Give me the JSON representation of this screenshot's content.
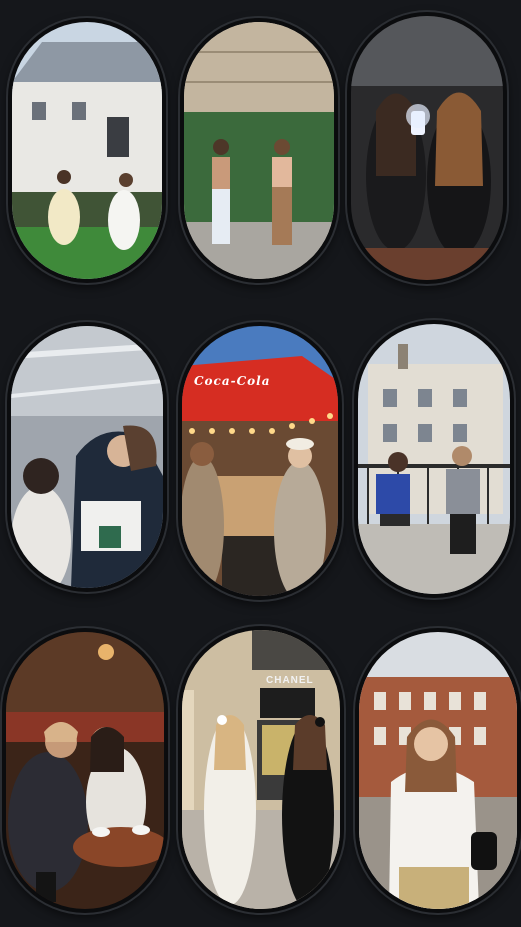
{
  "gallery": {
    "photos": [
      {
        "id": "p1",
        "depicts": "two-friends-dancing-lawn"
      },
      {
        "id": "p2",
        "depicts": "two-friends-dancing-street"
      },
      {
        "id": "p3",
        "depicts": "mirror-selfie-pair"
      },
      {
        "id": "p4",
        "depicts": "elevator-pair"
      },
      {
        "id": "p5",
        "depicts": "street-food-stall",
        "sign_text": "Coca-Cola"
      },
      {
        "id": "p6",
        "depicts": "balcony-cafe-pair"
      },
      {
        "id": "p7",
        "depicts": "cafe-table-laughing"
      },
      {
        "id": "p8",
        "depicts": "walking-by-boutique",
        "sign_text": "CHANEL"
      },
      {
        "id": "p9",
        "depicts": "street-portrait"
      }
    ]
  }
}
